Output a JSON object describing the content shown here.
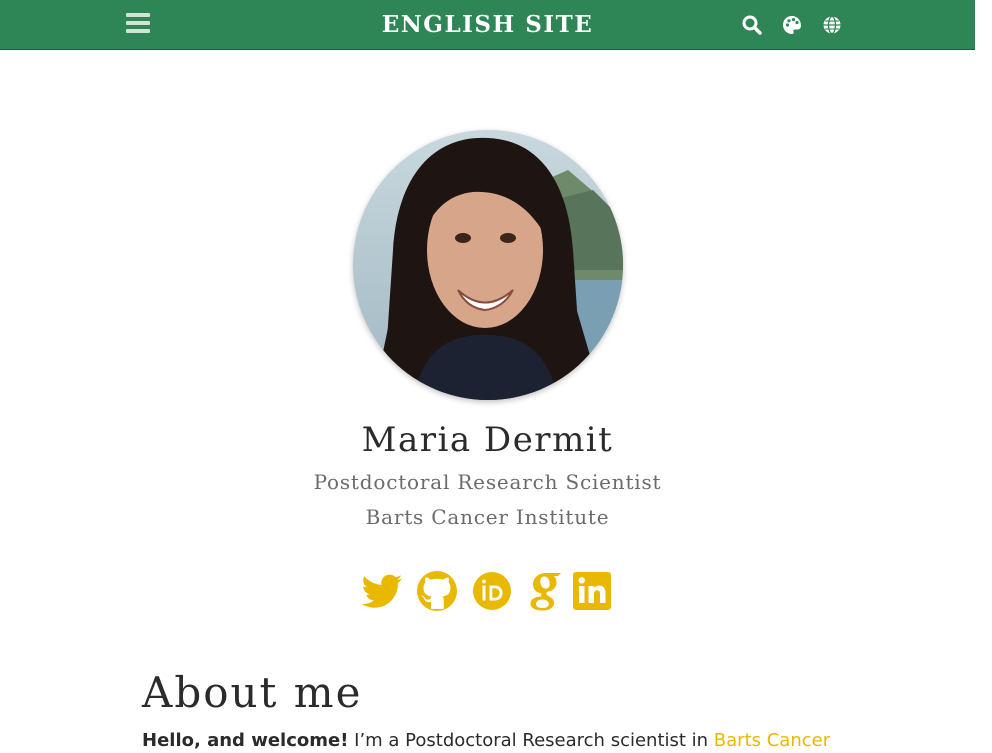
{
  "navbar": {
    "title": "ENGLISH SITE",
    "menu_icon": "hamburger-menu-icon",
    "icons": [
      "search-icon",
      "palette-icon",
      "globe-icon"
    ]
  },
  "profile": {
    "name": "Maria Dermit",
    "role": "Postdoctoral Research Scientist",
    "organization": "Barts Cancer Institute"
  },
  "social_icons": [
    "twitter-icon",
    "github-icon",
    "orcid-icon",
    "google-scholar-icon",
    "linkedin-icon"
  ],
  "about": {
    "heading": "About me",
    "intro_bold": "Hello, and welcome!",
    "intro_text": " I’m a Postdoctoral Research scientist in ",
    "intro_link": "Barts Cancer"
  },
  "colors": {
    "navbar": "#2e8555",
    "accent": "#e8b900",
    "text": "#2b2b2b",
    "muted": "#6b6b6b"
  }
}
